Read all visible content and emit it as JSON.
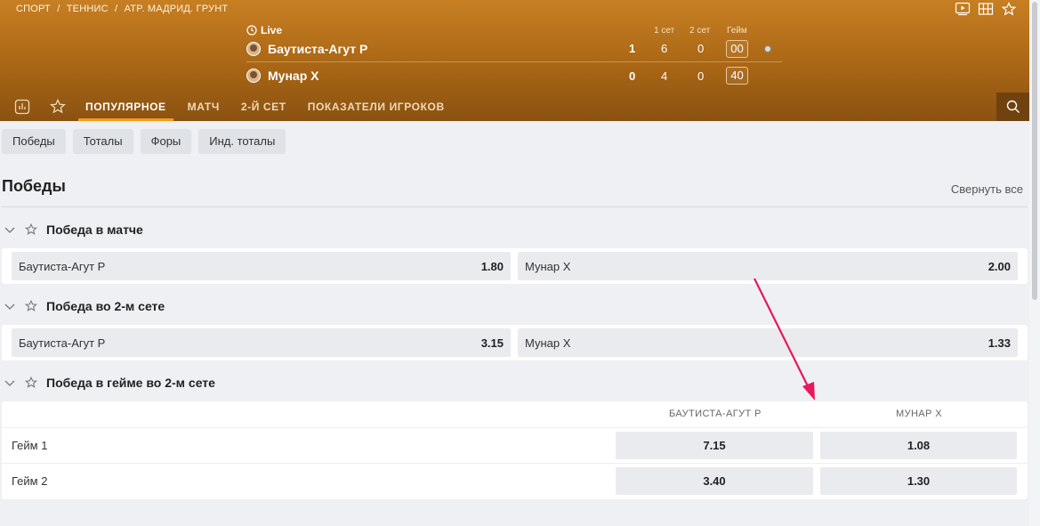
{
  "breadcrumb": [
    "СПОРТ",
    "/",
    "ТЕННИС",
    "/",
    "ATP. МАДРИД. ГРУНТ"
  ],
  "match": {
    "live_label": "Live",
    "columns": {
      "set1": "1 сет",
      "set2": "2 сет",
      "game": "Гейм"
    },
    "players": [
      {
        "name": "Баутиста-Агут Р",
        "sets_won": "1",
        "set1": "6",
        "set2": "0",
        "game": "00"
      },
      {
        "name": "Мунар Х",
        "sets_won": "0",
        "set1": "4",
        "set2": "0",
        "game": "40"
      }
    ]
  },
  "tabs": [
    "ПОПУЛЯРНОЕ",
    "МАТЧ",
    "2-Й СЕТ",
    "ПОКАЗАТЕЛИ ИГРОКОВ"
  ],
  "filters": [
    "Победы",
    "Тоталы",
    "Форы",
    "Инд. тоталы"
  ],
  "section": {
    "title": "Победы",
    "collapse_all": "Свернуть все"
  },
  "markets": [
    {
      "title": "Победа в матче",
      "outcomes": [
        {
          "name": "Баутиста-Агут Р",
          "odds": "1.80"
        },
        {
          "name": "Мунар Х",
          "odds": "2.00"
        }
      ]
    },
    {
      "title": "Победа во 2-м сете",
      "outcomes": [
        {
          "name": "Баутиста-Агут Р",
          "odds": "3.15"
        },
        {
          "name": "Мунар Х",
          "odds": "1.33"
        }
      ]
    },
    {
      "title": "Победа в гейме во 2-м сете",
      "headers": [
        "БАУТИСТА-АГУТ Р",
        "МУНАР Х"
      ],
      "rows": [
        {
          "label": "Гейм 1",
          "odds": [
            "7.15",
            "1.08"
          ]
        },
        {
          "label": "Гейм 2",
          "odds": [
            "3.40",
            "1.30"
          ]
        }
      ]
    }
  ],
  "colors": {
    "header_top": "#c77f22",
    "header_bottom": "#8a5211",
    "tab_active_underline": "#f59a1a",
    "annotation_arrow": "#e8185a"
  },
  "icons": [
    "video-icon",
    "scoreboard-icon",
    "favorite-star-icon",
    "clock-icon",
    "stats-icon",
    "star-icon",
    "search-icon",
    "chevron-down-icon"
  ]
}
